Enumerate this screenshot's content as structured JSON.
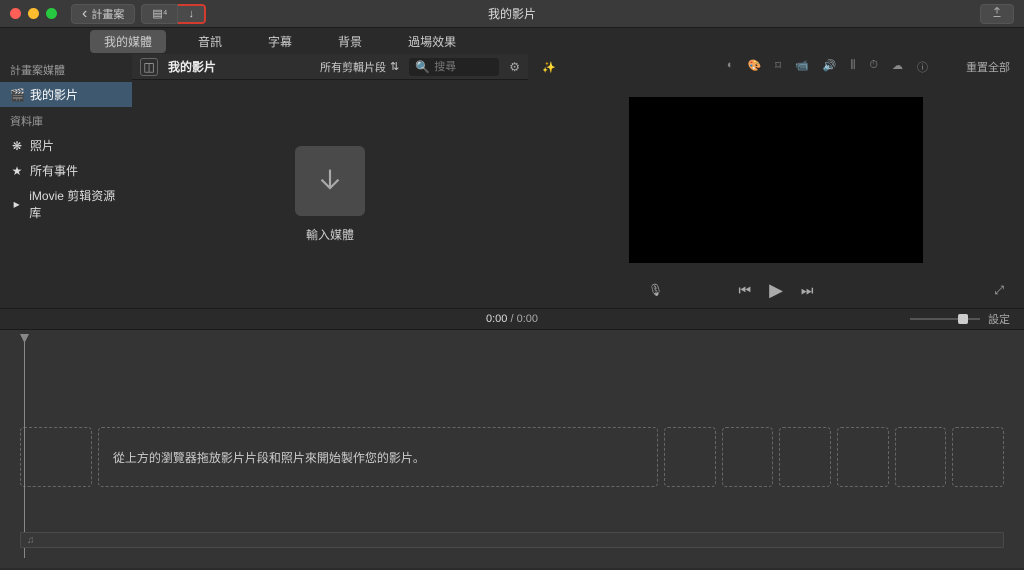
{
  "titlebar": {
    "back_label": "計畫案",
    "title": "我的影片"
  },
  "tabs": {
    "my_media": "我的媒體",
    "audio": "音訊",
    "subtitle": "字幕",
    "background": "背景",
    "transition": "過場效果"
  },
  "sidebar": {
    "project_media_header": "計畫案媒體",
    "my_movie": "我的影片",
    "library_header": "資料庫",
    "photos": "照片",
    "all_events": "所有事件",
    "imovie_library": "iMovie 剪辑资源库"
  },
  "browser": {
    "title": "我的影片",
    "filter_label": "所有剪輯片段",
    "search_placeholder": "搜尋",
    "import_label": "輸入媒體"
  },
  "viewer": {
    "reset_label": "重置全部"
  },
  "timeline_header": {
    "current_time": "0:00",
    "total_time": "0:00",
    "settings_label": "設定"
  },
  "timeline": {
    "hint": "從上方的瀏覽器拖放影片片段和照片來開始製作您的影片。"
  }
}
